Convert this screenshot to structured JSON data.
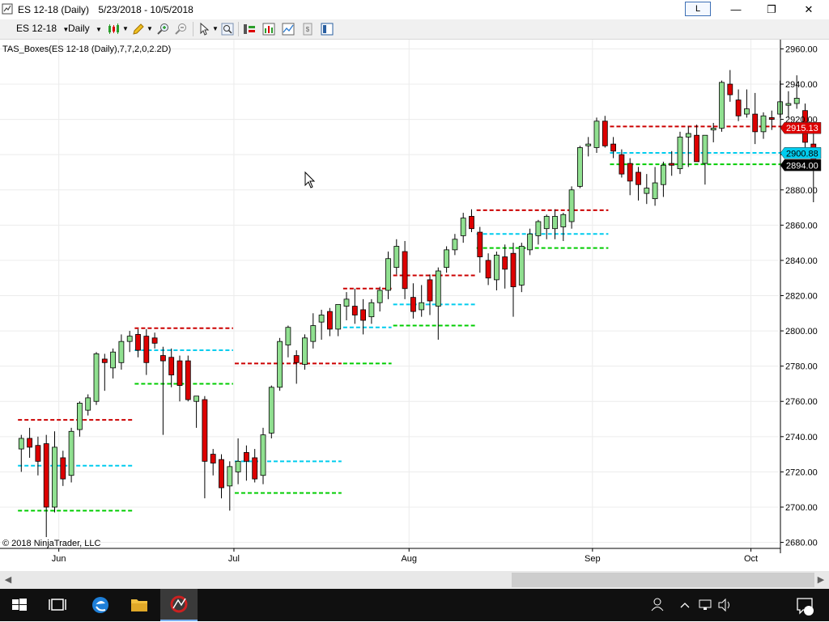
{
  "window": {
    "instrument": "ES 12-18 (Daily)",
    "date_range": "5/23/2018 - 10/5/2018",
    "badge": "L",
    "minimize": "—",
    "maximize": "❐",
    "close": "✕"
  },
  "toolbar": {
    "instrument": "ES 12-18",
    "interval": "Daily"
  },
  "chart": {
    "indicator": "TAS_Boxes(ES 12-18 (Daily),7,7,2,0,2.2D)",
    "copyright": "© 2018 NinjaTrader, LLC",
    "price_ticks": [
      "2960.00",
      "2940.00",
      "2920.00",
      "2900.00",
      "2880.00",
      "2860.00",
      "2840.00",
      "2820.00",
      "2800.00",
      "2780.00",
      "2760.00",
      "2740.00",
      "2720.00",
      "2700.00",
      "2680.00"
    ],
    "month_labels": [
      "Jun",
      "Jul",
      "Aug",
      "Sep",
      "Oct"
    ],
    "price_markers": [
      {
        "label": "2915.13",
        "color": "#dd0000"
      },
      {
        "label": "2900.88",
        "color": "#00ccee"
      },
      {
        "label": "2894.00",
        "color": "#000000"
      }
    ],
    "colors": {
      "up": "#90e090",
      "down": "#dd0000",
      "red_line": "#cc0000",
      "cyan_line": "#00ccee",
      "green_line": "#00cc00"
    }
  },
  "chart_data": {
    "type": "candlestick",
    "title": "ES 12-18 (Daily)",
    "ylim": [
      2670,
      2964
    ],
    "x_month_labels": [
      "Jun",
      "Jul",
      "Aug",
      "Sep",
      "Oct"
    ],
    "candles": [
      {
        "o": 2733,
        "h": 2741,
        "l": 2720,
        "c": 2739
      },
      {
        "o": 2739,
        "h": 2745,
        "l": 2728,
        "c": 2734
      },
      {
        "o": 2735,
        "h": 2740,
        "l": 2718,
        "c": 2726
      },
      {
        "o": 2736,
        "h": 2741,
        "l": 2683,
        "c": 2700
      },
      {
        "o": 2700,
        "h": 2743,
        "l": 2697,
        "c": 2734
      },
      {
        "o": 2728,
        "h": 2732,
        "l": 2712,
        "c": 2716
      },
      {
        "o": 2718,
        "h": 2745,
        "l": 2714,
        "c": 2743
      },
      {
        "o": 2744,
        "h": 2760,
        "l": 2740,
        "c": 2759
      },
      {
        "o": 2755,
        "h": 2764,
        "l": 2752,
        "c": 2762
      },
      {
        "o": 2760,
        "h": 2788,
        "l": 2758,
        "c": 2787
      },
      {
        "o": 2784,
        "h": 2787,
        "l": 2766,
        "c": 2782
      },
      {
        "o": 2779,
        "h": 2790,
        "l": 2773,
        "c": 2788
      },
      {
        "o": 2782,
        "h": 2798,
        "l": 2778,
        "c": 2794
      },
      {
        "o": 2794,
        "h": 2800,
        "l": 2788,
        "c": 2797
      },
      {
        "o": 2798,
        "h": 2801,
        "l": 2785,
        "c": 2789
      },
      {
        "o": 2797,
        "h": 2801,
        "l": 2775,
        "c": 2782
      },
      {
        "o": 2796,
        "h": 2799,
        "l": 2790,
        "c": 2793
      },
      {
        "o": 2786,
        "h": 2791,
        "l": 2741,
        "c": 2783
      },
      {
        "o": 2785,
        "h": 2790,
        "l": 2768,
        "c": 2775
      },
      {
        "o": 2783,
        "h": 2786,
        "l": 2760,
        "c": 2769
      },
      {
        "o": 2783,
        "h": 2786,
        "l": 2760,
        "c": 2761
      },
      {
        "o": 2760,
        "h": 2763,
        "l": 2745,
        "c": 2763
      },
      {
        "o": 2761,
        "h": 2763,
        "l": 2705,
        "c": 2726
      },
      {
        "o": 2730,
        "h": 2733,
        "l": 2718,
        "c": 2725
      },
      {
        "o": 2727,
        "h": 2730,
        "l": 2705,
        "c": 2711
      },
      {
        "o": 2712,
        "h": 2726,
        "l": 2698,
        "c": 2723
      },
      {
        "o": 2720,
        "h": 2739,
        "l": 2713,
        "c": 2726
      },
      {
        "o": 2731,
        "h": 2735,
        "l": 2715,
        "c": 2726
      },
      {
        "o": 2728,
        "h": 2733,
        "l": 2714,
        "c": 2716
      },
      {
        "o": 2718,
        "h": 2745,
        "l": 2713,
        "c": 2741
      },
      {
        "o": 2742,
        "h": 2769,
        "l": 2739,
        "c": 2768
      },
      {
        "o": 2768,
        "h": 2796,
        "l": 2766,
        "c": 2794
      },
      {
        "o": 2792,
        "h": 2803,
        "l": 2785,
        "c": 2802
      },
      {
        "o": 2786,
        "h": 2789,
        "l": 2770,
        "c": 2782
      },
      {
        "o": 2781,
        "h": 2798,
        "l": 2778,
        "c": 2796
      },
      {
        "o": 2794,
        "h": 2810,
        "l": 2790,
        "c": 2803
      },
      {
        "o": 2805,
        "h": 2812,
        "l": 2795,
        "c": 2809
      },
      {
        "o": 2811,
        "h": 2813,
        "l": 2797,
        "c": 2801
      },
      {
        "o": 2801,
        "h": 2815,
        "l": 2797,
        "c": 2815
      },
      {
        "o": 2814,
        "h": 2822,
        "l": 2806,
        "c": 2818
      },
      {
        "o": 2814,
        "h": 2824,
        "l": 2804,
        "c": 2809
      },
      {
        "o": 2812,
        "h": 2818,
        "l": 2798,
        "c": 2806
      },
      {
        "o": 2808,
        "h": 2818,
        "l": 2804,
        "c": 2816
      },
      {
        "o": 2816,
        "h": 2825,
        "l": 2811,
        "c": 2823
      },
      {
        "o": 2823,
        "h": 2845,
        "l": 2818,
        "c": 2841
      },
      {
        "o": 2836,
        "h": 2852,
        "l": 2832,
        "c": 2848
      },
      {
        "o": 2845,
        "h": 2851,
        "l": 2818,
        "c": 2824
      },
      {
        "o": 2819,
        "h": 2827,
        "l": 2807,
        "c": 2811
      },
      {
        "o": 2812,
        "h": 2826,
        "l": 2808,
        "c": 2816
      },
      {
        "o": 2829,
        "h": 2832,
        "l": 2809,
        "c": 2817
      },
      {
        "o": 2814,
        "h": 2836,
        "l": 2795,
        "c": 2834
      },
      {
        "o": 2836,
        "h": 2848,
        "l": 2833,
        "c": 2846
      },
      {
        "o": 2846,
        "h": 2855,
        "l": 2843,
        "c": 2852
      },
      {
        "o": 2854,
        "h": 2867,
        "l": 2850,
        "c": 2864
      },
      {
        "o": 2865,
        "h": 2869,
        "l": 2856,
        "c": 2858
      },
      {
        "o": 2856,
        "h": 2859,
        "l": 2833,
        "c": 2842
      },
      {
        "o": 2840,
        "h": 2844,
        "l": 2826,
        "c": 2830
      },
      {
        "o": 2829,
        "h": 2845,
        "l": 2823,
        "c": 2843
      },
      {
        "o": 2842,
        "h": 2849,
        "l": 2824,
        "c": 2835
      },
      {
        "o": 2844,
        "h": 2850,
        "l": 2808,
        "c": 2825
      },
      {
        "o": 2826,
        "h": 2850,
        "l": 2822,
        "c": 2848
      },
      {
        "o": 2846,
        "h": 2858,
        "l": 2843,
        "c": 2855
      },
      {
        "o": 2854,
        "h": 2863,
        "l": 2849,
        "c": 2862
      },
      {
        "o": 2858,
        "h": 2866,
        "l": 2852,
        "c": 2865
      },
      {
        "o": 2858,
        "h": 2869,
        "l": 2852,
        "c": 2865
      },
      {
        "o": 2859,
        "h": 2867,
        "l": 2851,
        "c": 2866
      },
      {
        "o": 2862,
        "h": 2882,
        "l": 2858,
        "c": 2880
      },
      {
        "o": 2882,
        "h": 2905,
        "l": 2881,
        "c": 2904
      },
      {
        "o": 2905,
        "h": 2910,
        "l": 2899,
        "c": 2906
      },
      {
        "o": 2904,
        "h": 2921,
        "l": 2901,
        "c": 2919
      },
      {
        "o": 2919,
        "h": 2922,
        "l": 2904,
        "c": 2905
      },
      {
        "o": 2906,
        "h": 2910,
        "l": 2898,
        "c": 2902
      },
      {
        "o": 2900,
        "h": 2903,
        "l": 2887,
        "c": 2889
      },
      {
        "o": 2895,
        "h": 2898,
        "l": 2877,
        "c": 2885
      },
      {
        "o": 2890,
        "h": 2893,
        "l": 2874,
        "c": 2883
      },
      {
        "o": 2878,
        "h": 2889,
        "l": 2872,
        "c": 2881
      },
      {
        "o": 2875,
        "h": 2893,
        "l": 2871,
        "c": 2884
      },
      {
        "o": 2883,
        "h": 2896,
        "l": 2876,
        "c": 2894
      },
      {
        "o": 2895,
        "h": 2902,
        "l": 2888,
        "c": 2894
      },
      {
        "o": 2892,
        "h": 2913,
        "l": 2889,
        "c": 2910
      },
      {
        "o": 2910,
        "h": 2916,
        "l": 2893,
        "c": 2912
      },
      {
        "o": 2911,
        "h": 2917,
        "l": 2896,
        "c": 2896
      },
      {
        "o": 2895,
        "h": 2911,
        "l": 2883,
        "c": 2911
      },
      {
        "o": 2914,
        "h": 2918,
        "l": 2907,
        "c": 2915
      },
      {
        "o": 2915,
        "h": 2942,
        "l": 2913,
        "c": 2941
      },
      {
        "o": 2940,
        "h": 2948,
        "l": 2930,
        "c": 2934
      },
      {
        "o": 2931,
        "h": 2937,
        "l": 2919,
        "c": 2922
      },
      {
        "o": 2923,
        "h": 2937,
        "l": 2921,
        "c": 2926
      },
      {
        "o": 2923,
        "h": 2935,
        "l": 2906,
        "c": 2913
      },
      {
        "o": 2913,
        "h": 2924,
        "l": 2909,
        "c": 2922
      },
      {
        "o": 2921,
        "h": 2925,
        "l": 2914,
        "c": 2920
      },
      {
        "o": 2923,
        "h": 2942,
        "l": 2921,
        "c": 2930
      },
      {
        "o": 2928,
        "h": 2936,
        "l": 2921,
        "c": 2929
      },
      {
        "o": 2929,
        "h": 2945,
        "l": 2926,
        "c": 2932
      },
      {
        "o": 2925,
        "h": 2929,
        "l": 2901,
        "c": 2907
      },
      {
        "o": 2906,
        "h": 2915,
        "l": 2873,
        "c": 2894
      }
    ],
    "boxes": [
      {
        "from": 1,
        "to": 14,
        "red": 2749.5,
        "cyan": 2723.5,
        "green": 2698.0
      },
      {
        "from": 15,
        "to": 26,
        "red": 2801.5,
        "cyan": 2789.0,
        "green": 2770.0
      },
      {
        "from": 27,
        "to": 39,
        "red": 2781.5,
        "cyan": 2726.0,
        "green": 2708.0
      },
      {
        "from": 40,
        "to": 45,
        "red": 2824.0,
        "cyan": 2802.0,
        "green": 2781.5
      },
      {
        "from": 46,
        "to": 55,
        "red": 2831.5,
        "cyan": 2815.0,
        "green": 2803.0
      },
      {
        "from": 56,
        "to": 71,
        "red": 2868.5,
        "cyan": 2855.0,
        "green": 2847.0
      },
      {
        "from": 72,
        "to": 96,
        "red": 2916.0,
        "cyan": 2901.0,
        "green": 2894.5
      }
    ]
  }
}
